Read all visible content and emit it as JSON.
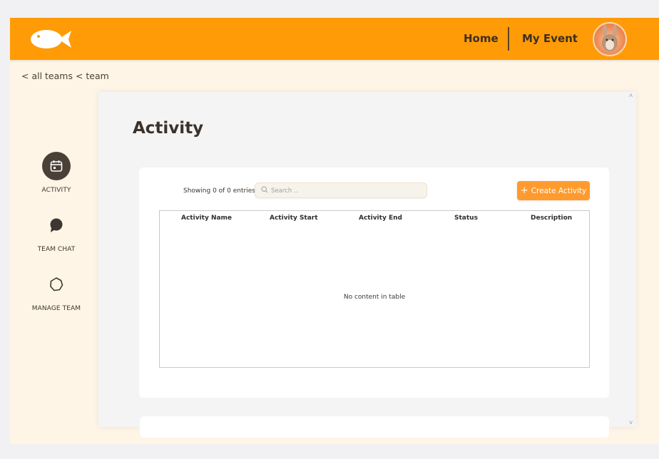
{
  "header": {
    "logo_icon": "fish-logo-icon",
    "nav_home": "Home",
    "nav_my_event": "My Event",
    "avatar_icon": "user-avatar",
    "bg_color": "#ff9b06"
  },
  "breadcrumb": "< all teams < team",
  "sidebar": {
    "items": [
      {
        "label": "ACTIVITY",
        "icon": "calendar-icon",
        "active": true
      },
      {
        "label": "TEAM CHAT",
        "icon": "chat-bubble-icon",
        "active": false
      },
      {
        "label": "MANAGE TEAM",
        "icon": "gear-icon",
        "active": false
      }
    ]
  },
  "main": {
    "title": "Activity",
    "showing": "Showing 0 of 0 entries",
    "search_placeholder": "Search ..",
    "create_button": "Create Activity",
    "table": {
      "columns": [
        "Activity Name",
        "Activity Start",
        "Activity End",
        "Status",
        "Description"
      ],
      "rows": [],
      "empty_text": "No content in table"
    }
  },
  "scroll": {
    "up": "˄",
    "down": "˅"
  }
}
